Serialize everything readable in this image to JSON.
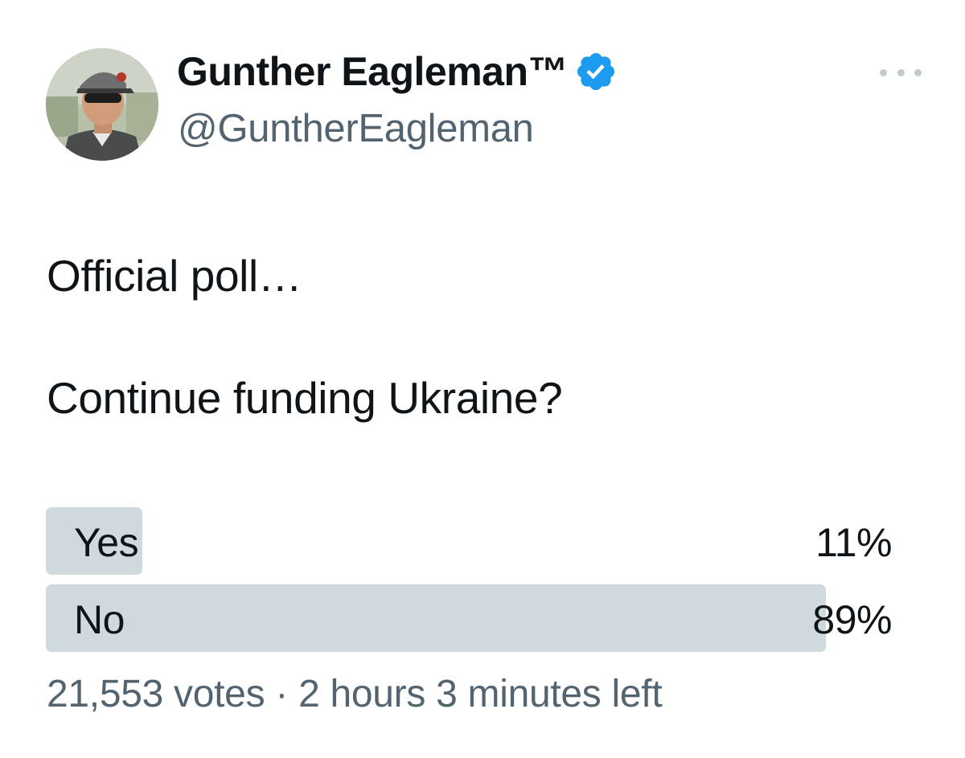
{
  "author": {
    "display_name": "Gunther Eagleman™",
    "handle": "@GuntherEagleman",
    "verified": true,
    "avatar_icon": "profile-photo",
    "verified_icon": "verified-badge-icon",
    "more_icon": "more-options-icon"
  },
  "tweet": {
    "text_line_1": "Official poll…",
    "text_line_2": "Continue funding Ukraine?"
  },
  "poll": {
    "options": [
      {
        "label": "Yes",
        "percent_text": "11%",
        "percent": 11
      },
      {
        "label": "No",
        "percent_text": "89%",
        "percent": 89
      }
    ],
    "votes": "21,553 votes",
    "separator": "·",
    "time_left": "2 hours 3 minutes left"
  },
  "colors": {
    "verified_blue": "#1d9bf0",
    "poll_bar": "#cfd9de",
    "secondary_text": "#536471"
  }
}
